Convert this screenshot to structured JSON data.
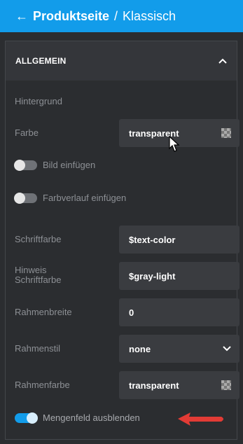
{
  "header": {
    "back_icon": "←",
    "page": "Produktseite",
    "separator": "/",
    "subpage": "Klassisch",
    "color": "#129cea"
  },
  "section": {
    "title": "ALLGEMEIN",
    "icon": "chevron-up-icon"
  },
  "background": {
    "group_label": "Hintergrund",
    "color_label": "Farbe",
    "color_value": "transparent",
    "insert_image_label": "Bild einfügen",
    "insert_gradient_label": "Farbverlauf einfügen"
  },
  "fields": {
    "font_color_label": "Schriftfarbe",
    "font_color_value": "$text-color",
    "hint_font_color_label_1": "Hinweis",
    "hint_font_color_label_2": "Schriftfarbe",
    "hint_font_color_value": "$gray-light",
    "border_width_label": "Rahmenbreite",
    "border_width_value": "0",
    "border_style_label": "Rahmenstil",
    "border_style_value": "none",
    "border_color_label": "Rahmenfarbe",
    "border_color_value": "transparent"
  },
  "quantity_toggle": {
    "label": "Mengenfeld ausblenden",
    "enabled": true
  },
  "annotation_arrow_color": "#e23b35"
}
